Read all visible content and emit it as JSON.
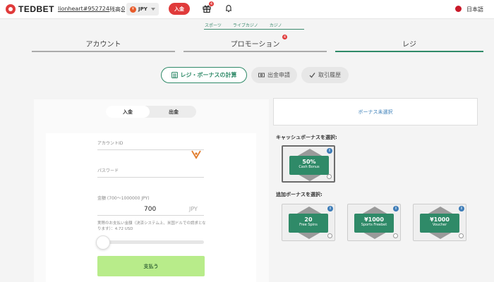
{
  "header": {
    "logo_text": "TEDBET",
    "user_id": "lionheart#952724",
    "balance_label": "残高:",
    "balance_value": "0",
    "currency_symbol": "¥",
    "currency": "JPY",
    "deposit_label": "入金",
    "gift_badge": "4",
    "language": "日本語"
  },
  "subnav": {
    "items": [
      "スポーツ",
      "ライブカジノ",
      "カジノ"
    ]
  },
  "tabs": [
    {
      "label": "アカウント",
      "active": false
    },
    {
      "label": "プロモーション",
      "active": false,
      "badge": "4"
    },
    {
      "label": "レジ",
      "active": true
    }
  ],
  "cashier_menu": {
    "calc": "レジ・ボーナスの計算",
    "withdraw": "出金申請",
    "history": "取引履歴"
  },
  "form": {
    "toggle_deposit": "入金",
    "toggle_withdraw": "出金",
    "account_id_label": "アカウントID",
    "password_label": "パスワード",
    "amount_label": "金額 (700～1000000 JPY)",
    "amount_value": "700",
    "amount_currency": "JPY",
    "note": "実際のお支払い金額（決済システム上、米国ドルでの請求となります）：4.72 USD",
    "slider_position": 0,
    "pay_button": "支払う"
  },
  "bonus": {
    "select_label": "ボーナス未選択",
    "cash_bonus_title": "キャッシュボーナスを選択:",
    "additional_bonus_title": "追加ボーナスを選択:",
    "cash_bonuses": [
      {
        "value": "50%",
        "label": "Cash Bonus",
        "selected": true
      }
    ],
    "additional_bonuses": [
      {
        "value": "20",
        "label": "Free Spins"
      },
      {
        "value": "¥1000",
        "label": "Sports Freebet"
      },
      {
        "value": "¥1000",
        "label": "Voucher"
      }
    ]
  },
  "colors": {
    "brand_red": "#e03b3b",
    "accent_green": "#2f8a68",
    "pay_button": "#b8ec8a",
    "info_blue": "#3e7db8"
  },
  "icons": {
    "logo": "tedbet-logo-icon",
    "gift": "gift-icon",
    "notification": "bell-icon",
    "language_flag": "japan-flag-icon",
    "calculator": "calculator-icon",
    "withdraw": "cash-icon",
    "history": "check-icon",
    "account_id": "vera-john-logo-icon",
    "info": "info-icon"
  }
}
